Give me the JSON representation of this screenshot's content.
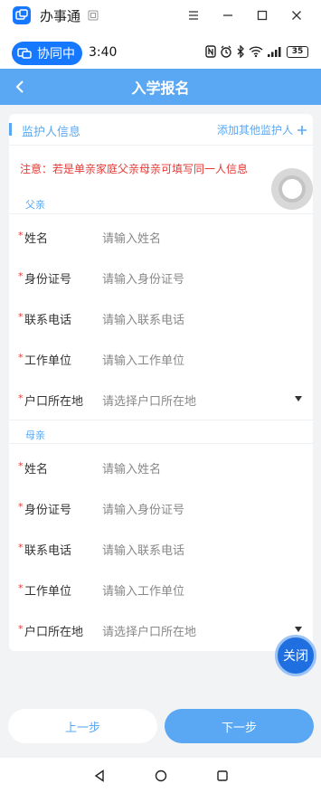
{
  "window": {
    "title": "办事通"
  },
  "statusbar": {
    "collab_label": "协同中",
    "time": "3:40",
    "battery": "35"
  },
  "header": {
    "title": "入学报名"
  },
  "section": {
    "title": "监护人信息",
    "add_link": "添加其他监护人"
  },
  "notice": "注意：若是单亲家庭父亲母亲可填写同一人信息",
  "father": {
    "group_label": "父亲",
    "fields": [
      {
        "label": "姓名",
        "placeholder": "请输入姓名"
      },
      {
        "label": "身份证号",
        "placeholder": "请输入身份证号"
      },
      {
        "label": "联系电话",
        "placeholder": "请输入联系电话"
      },
      {
        "label": "工作单位",
        "placeholder": "请输入工作单位"
      },
      {
        "label": "户口所在地",
        "placeholder": "请选择户口所在地"
      }
    ]
  },
  "mother": {
    "group_label": "母亲",
    "fields": [
      {
        "label": "姓名",
        "placeholder": "请输入姓名"
      },
      {
        "label": "身份证号",
        "placeholder": "请输入身份证号"
      },
      {
        "label": "联系电话",
        "placeholder": "请输入联系电话"
      },
      {
        "label": "工作单位",
        "placeholder": "请输入工作单位"
      },
      {
        "label": "户口所在地",
        "placeholder": "请选择户口所在地"
      }
    ]
  },
  "required_mark": "*",
  "floating": {
    "close_label": "关闭"
  },
  "buttons": {
    "prev": "上一步",
    "next": "下一步"
  },
  "colors": {
    "accent": "#5aa8f4",
    "brand": "#1677ff",
    "required": "#e53935"
  }
}
